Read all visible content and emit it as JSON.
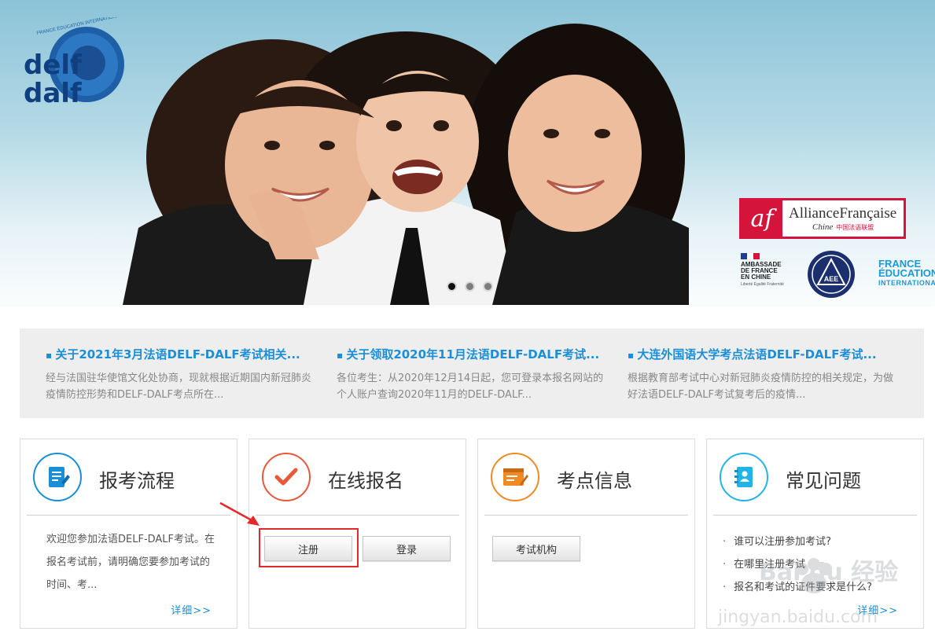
{
  "banner": {
    "logo_line1": "delf",
    "logo_line2": "dalf",
    "logo_ring_text": "FRANCE ÉDUCATION INTERNATIONAL",
    "af_mark": "af",
    "af_name": "AllianceFrançaise",
    "af_sub": "Chine",
    "af_sub_cn": "中国法语联盟",
    "ambassade_lines": [
      "AMBASSADE",
      "DE FRANCE",
      "EN CHINE"
    ],
    "ambassade_motto": "Liberté Égalité Fraternité",
    "aee_text": "AEE",
    "fei_lines": [
      "FRANCE",
      "ÉDUCATION",
      "INTERNATIONAL"
    ],
    "carousel_dots": 3,
    "active_dot": 0
  },
  "news": [
    {
      "title": "关于2021年3月法语DELF-DALF考试相关...",
      "text": "经与法国驻华使馆文化处协商，现就根据近期国内新冠肺炎疫情防控形势和DELF-DALF考点所在..."
    },
    {
      "title": "关于领取2020年11月法语DELF-DALF考试...",
      "text": "各位考生：从2020年12月14日起，您可登录本报名网站的个人账户查询2020年11月的DELF-DALF..."
    },
    {
      "title": "大连外国语大学考点法语DELF-DALF考试...",
      "text": "根据教育部考试中心对新冠肺炎疫情防控的相关规定，为做好法语DELF-DALF考试复考后的疫情..."
    }
  ],
  "cards": {
    "process": {
      "title": "报考流程",
      "desc": "欢迎您参加法语DELF-DALF考试。在报名考试前，请明确您要参加考试的时间、考...",
      "more": "详细>>",
      "icon": "document-icon"
    },
    "register": {
      "title": "在线报名",
      "btn_register": "注册",
      "btn_login": "登录",
      "icon": "checkmark-icon"
    },
    "centers": {
      "title": "考点信息",
      "btn_centers": "考试机构",
      "icon": "browser-edit-icon"
    },
    "faq": {
      "title": "常见问题",
      "items": [
        "谁可以注册参加考试?",
        "在哪里注册考试",
        "报名和考试的证件要求是什么?"
      ],
      "more": "详细>>",
      "icon": "contact-book-icon"
    }
  },
  "watermark": {
    "brand": "Bai du 经验",
    "url": "jingyan.baidu.com"
  },
  "colors": {
    "accent_blue": "#1a8ed6",
    "highlight_red": "#e32a2a",
    "orange": "#f08a24",
    "cyan": "#23b4e6"
  }
}
